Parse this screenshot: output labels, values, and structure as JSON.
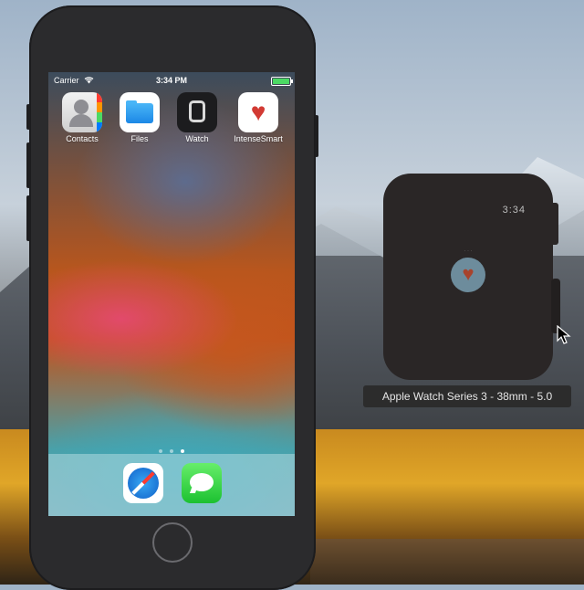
{
  "phone": {
    "status_bar": {
      "carrier": "Carrier",
      "time": "3:34 PM",
      "wifi_icon": "wifi-icon",
      "battery_level": 1.0,
      "battery_color": "#4cd964"
    },
    "apps": [
      {
        "label": "Contacts",
        "icon": "contacts-icon"
      },
      {
        "label": "Files",
        "icon": "files-icon"
      },
      {
        "label": "Watch",
        "icon": "watch-icon"
      },
      {
        "label": "IntenseSmart",
        "icon": "heart-runner-icon"
      }
    ],
    "page_dots": {
      "count": 3,
      "active_index": 2
    },
    "dock": [
      {
        "name": "Safari",
        "icon": "safari-icon"
      },
      {
        "name": "Messages",
        "icon": "messages-icon"
      }
    ]
  },
  "watch": {
    "time": "3:34",
    "app_icon": "heart-icon",
    "tooltip": "Apple Watch Series 3 - 38mm - 5.0"
  }
}
